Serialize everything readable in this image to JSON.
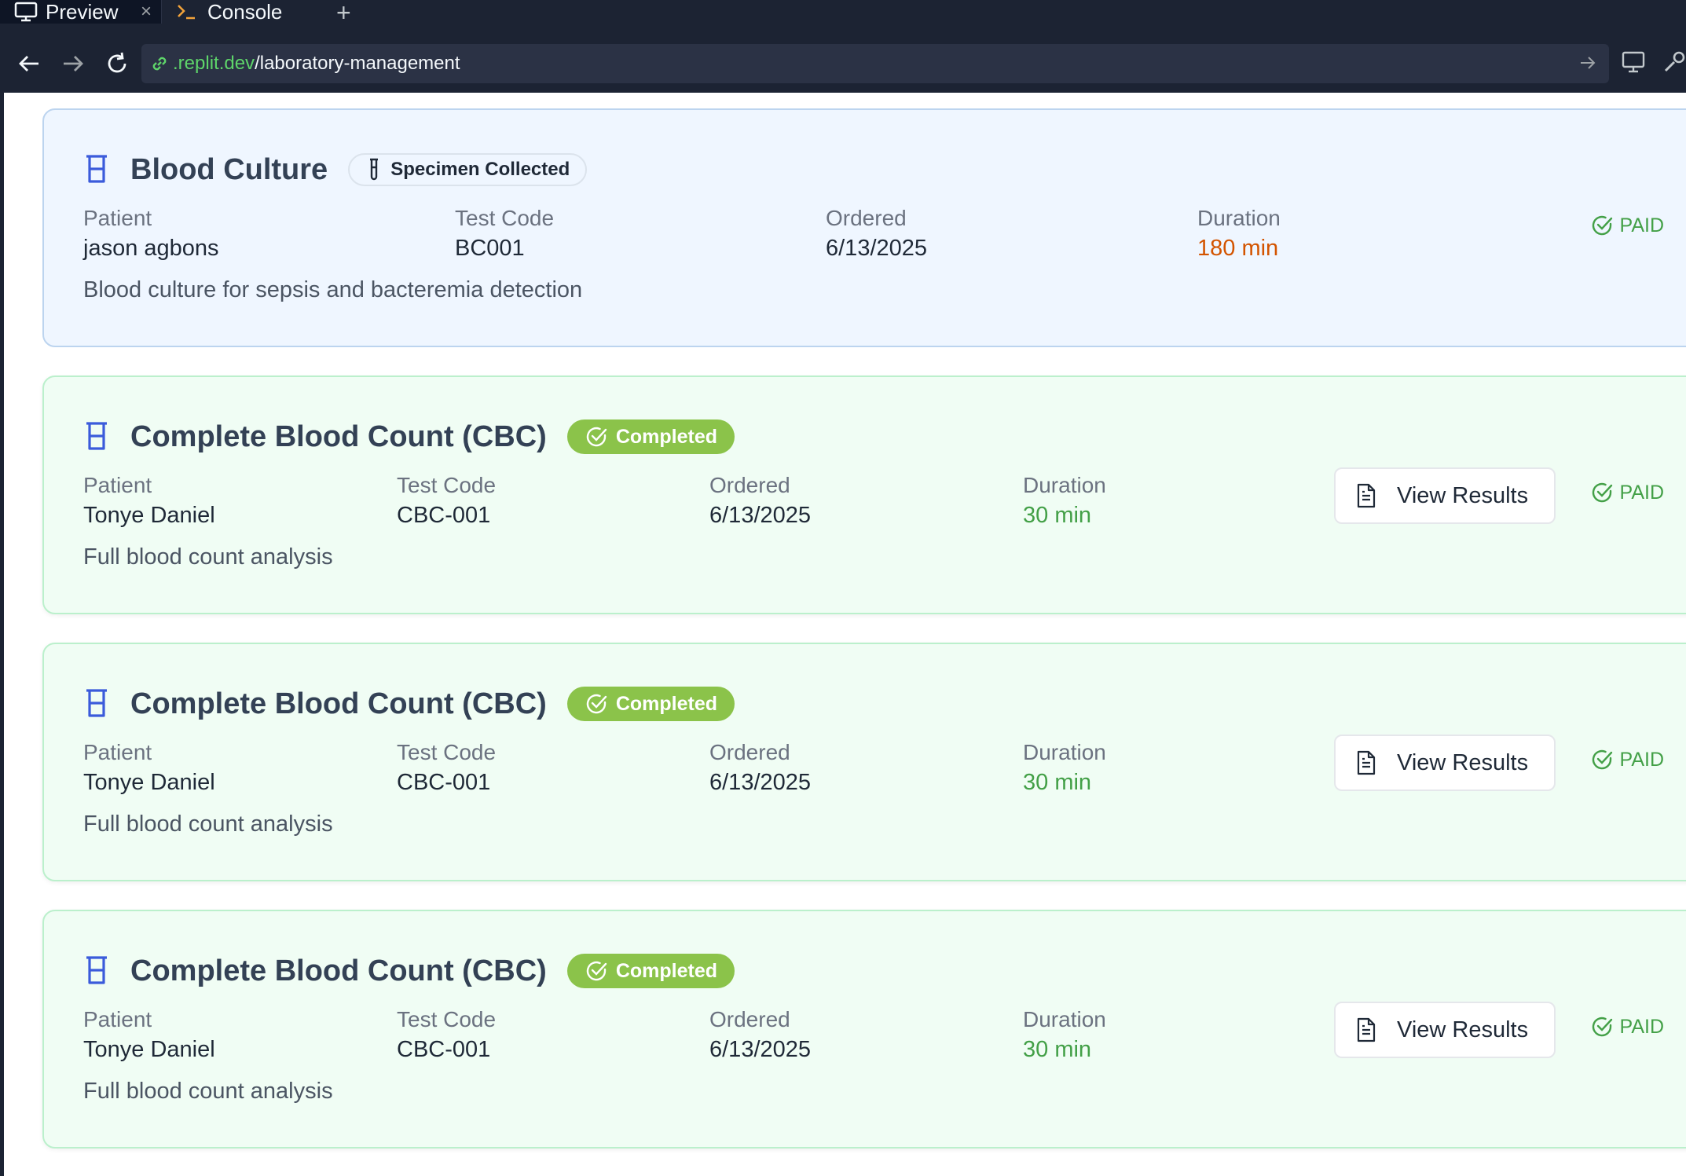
{
  "browser": {
    "tabs": [
      {
        "label": "Preview",
        "icon": "monitor-icon"
      },
      {
        "label": "Console",
        "icon": "terminal-icon"
      }
    ],
    "close_glyph": "×",
    "new_tab_glyph": "+",
    "url_host": ".replit.dev",
    "url_path": "/laboratory-management"
  },
  "colors": {
    "accent_blue": "#3b5bdb",
    "completed_green": "#8bc34a",
    "paid_green": "#43a047",
    "duration_orange": "#d35400"
  },
  "labels": {
    "patient": "Patient",
    "test_code": "Test Code",
    "ordered": "Ordered",
    "duration": "Duration",
    "paid": "PAID",
    "view_results": "View Results"
  },
  "tests": [
    {
      "name": "Blood Culture",
      "status": "Specimen Collected",
      "patient": "jason agbons",
      "code": "BC001",
      "ordered": "6/13/2025",
      "duration": "180 min",
      "description": "Blood culture for sepsis and bacteremia detection",
      "payment": "PAID"
    },
    {
      "name": "Complete Blood Count (CBC)",
      "status": "Completed",
      "patient": "Tonye Daniel",
      "code": "CBC-001",
      "ordered": "6/13/2025",
      "duration": "30 min",
      "description": "Full blood count analysis",
      "payment": "PAID"
    },
    {
      "name": "Complete Blood Count (CBC)",
      "status": "Completed",
      "patient": "Tonye Daniel",
      "code": "CBC-001",
      "ordered": "6/13/2025",
      "duration": "30 min",
      "description": "Full blood count analysis",
      "payment": "PAID"
    },
    {
      "name": "Complete Blood Count (CBC)",
      "status": "Completed",
      "patient": "Tonye Daniel",
      "code": "CBC-001",
      "ordered": "6/13/2025",
      "duration": "30 min",
      "description": "Full blood count analysis",
      "payment": "PAID"
    }
  ]
}
